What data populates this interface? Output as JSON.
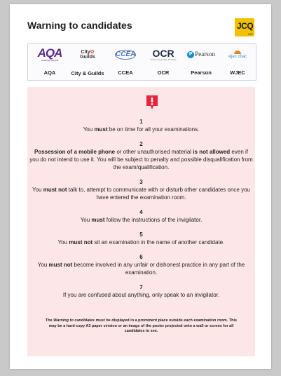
{
  "header": {
    "title": "Warning to candidates",
    "jcq_logo": "JCQ",
    "jcq_sub": "CIC"
  },
  "boards": [
    {
      "name": "AQA",
      "logo": "AQA",
      "logo_sub": "Realising potential"
    },
    {
      "name": "City & Guilds",
      "logo": "City Guilds"
    },
    {
      "name": "CCEA",
      "logo": "CCEA"
    },
    {
      "name": "OCR",
      "logo": "OCR",
      "logo_sub": "Oxford Cambridge and RSA"
    },
    {
      "name": "Pearson",
      "logo": "Pearson"
    },
    {
      "name": "WJEC",
      "logo": "wjec cbac"
    }
  ],
  "rules": [
    {
      "num": "1",
      "a": "You ",
      "b1": "must",
      "c": " be on time for all your examinations."
    },
    {
      "num": "2",
      "a": "",
      "b1": "Possession of a mobile phone",
      "c": " or other unauthorised material ",
      "b2": "is not allowed",
      "d": " even if you do not intend to use it. You will be subject to penalty and possible disqualification from the exam/qualification."
    },
    {
      "num": "3",
      "a": "You ",
      "b1": "must not",
      "c": " talk to, attempt to communicate with or disturb other candidates once you have entered the examination room."
    },
    {
      "num": "4",
      "a": "You ",
      "b1": "must",
      "c": " follow the instructions of the invigilator."
    },
    {
      "num": "5",
      "a": "You ",
      "b1": "must not",
      "c": " sit an examination in the name of another candidate."
    },
    {
      "num": "6",
      "a": "You ",
      "b1": "must not",
      "c": " become involved in any unfair or dishonest practice in any part of the examination."
    },
    {
      "num": "7",
      "a": "If you are confused about anything, only speak to an invigilator.",
      "b1": "",
      "c": ""
    }
  ],
  "footnote": {
    "a": "The ",
    "italic": "Warning to candidates",
    "b": " must be displayed in a prominent place outside each examination room. This may be a hard copy A3 paper version or an image of the poster projected onto a wall or screen for all candidates to see."
  },
  "colors": {
    "panel": "#fde6e8",
    "icon": "#e8243c",
    "jcq": "#f2c100",
    "aqa": "#5a2a86"
  }
}
